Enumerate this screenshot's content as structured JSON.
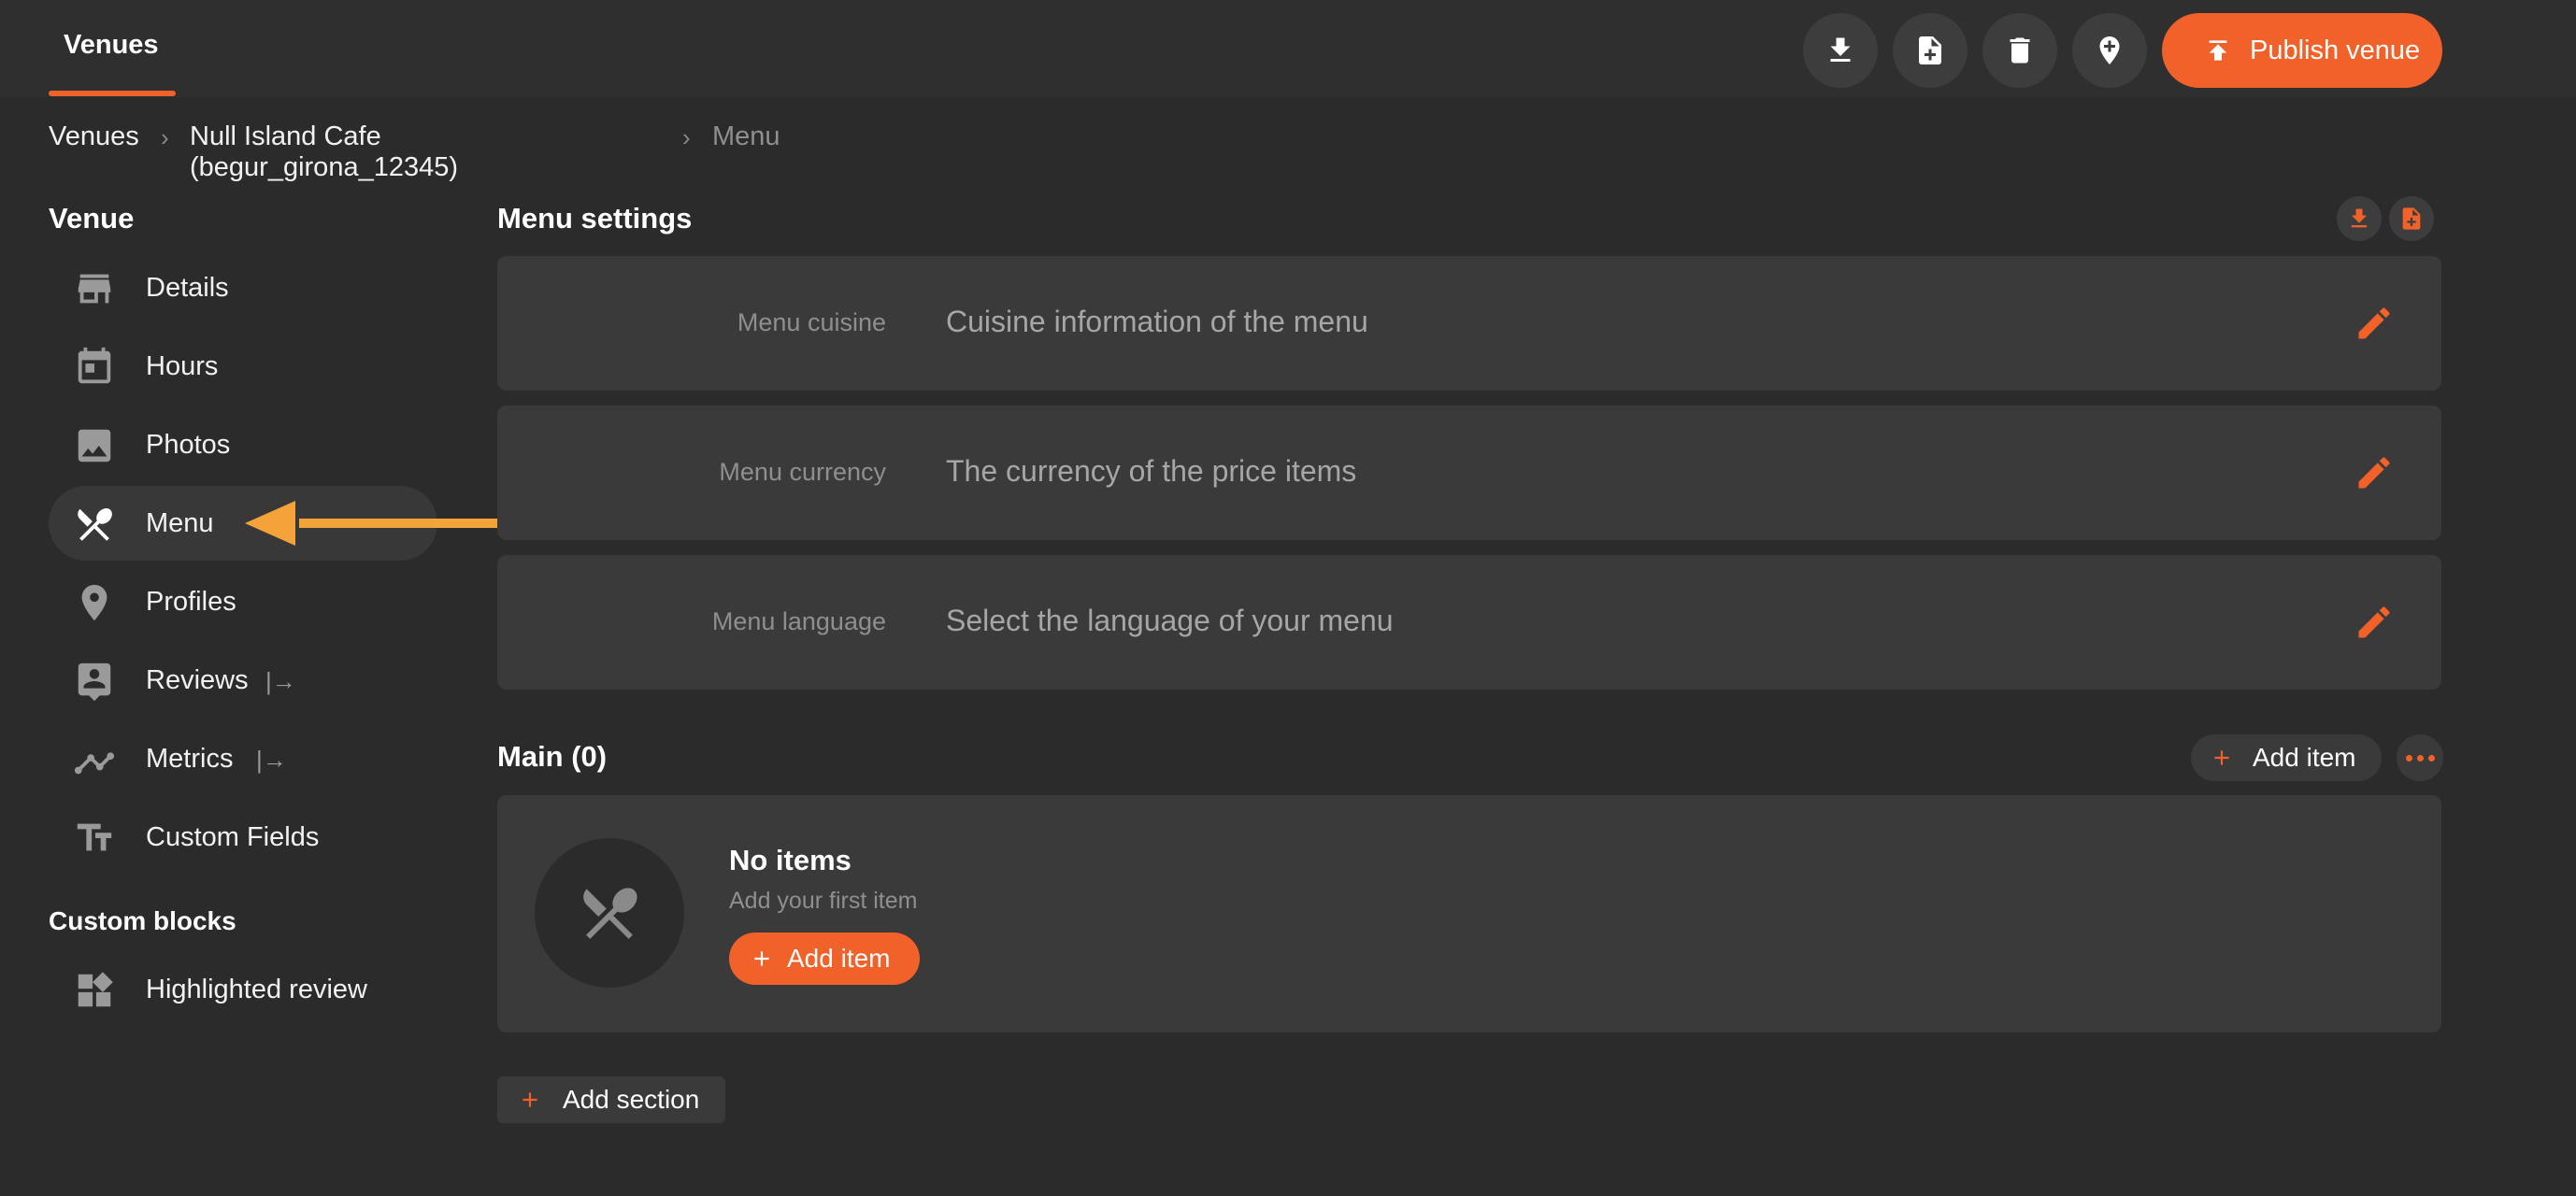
{
  "topbar": {
    "tab_label": "Venues",
    "icons": [
      "download-icon",
      "new-document-icon",
      "trash-icon",
      "add-location-icon"
    ],
    "publish_label": "Publish venue"
  },
  "breadcrumb": {
    "items": [
      "Venues",
      "Null Island Cafe (begur_girona_12345)",
      "Menu"
    ]
  },
  "sidebar": {
    "heading": "Venue",
    "items": [
      {
        "label": "Details",
        "icon": "storefront-icon"
      },
      {
        "label": "Hours",
        "icon": "calendar-icon"
      },
      {
        "label": "Photos",
        "icon": "image-icon"
      },
      {
        "label": "Menu",
        "icon": "utensils-icon",
        "active": true
      },
      {
        "label": "Profiles",
        "icon": "location-pin-icon"
      },
      {
        "label": "Reviews",
        "icon": "reviews-icon",
        "external": "|→"
      },
      {
        "label": "Metrics",
        "icon": "metrics-icon",
        "external": "|→"
      },
      {
        "label": "Custom Fields",
        "icon": "text-fields-icon"
      }
    ],
    "custom_heading": "Custom blocks",
    "custom_items": [
      {
        "label": "Highlighted review",
        "icon": "widgets-icon"
      }
    ]
  },
  "main": {
    "settings_title": "Menu settings",
    "settings": [
      {
        "label": "Menu cuisine",
        "value": "Cuisine information of the menu"
      },
      {
        "label": "Menu currency",
        "value": "The currency of the price items"
      },
      {
        "label": "Menu language",
        "value": "Select the language of your menu"
      }
    ],
    "section_title": "Main (0)",
    "add_item_label": "Add item",
    "empty": {
      "title": "No items",
      "subtitle": "Add your first item",
      "button": "Add item"
    },
    "add_section_label": "Add section"
  },
  "colors": {
    "accent": "#f0622a",
    "background": "#2b2b2b",
    "card": "#3a3a3a",
    "annotation_arrow": "#f3a33a"
  }
}
